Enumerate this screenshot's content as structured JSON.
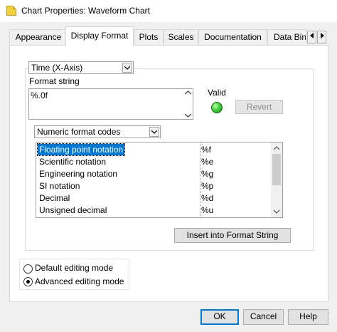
{
  "window": {
    "title": "Chart Properties: Waveform Chart"
  },
  "tabs": [
    {
      "label": "Appearance",
      "active": false
    },
    {
      "label": "Display Format",
      "active": true
    },
    {
      "label": "Plots",
      "active": false
    },
    {
      "label": "Scales",
      "active": false
    },
    {
      "label": "Documentation",
      "active": false
    },
    {
      "label": "Data Bin",
      "active": false
    }
  ],
  "tab_scroll": {
    "left_icon": "triangle-left-icon",
    "right_icon": "triangle-right-icon"
  },
  "display_format": {
    "axis_select": {
      "value": "Time (X-Axis)"
    },
    "format_string": {
      "label": "Format string",
      "value": "%.0f"
    },
    "valid": {
      "label": "Valid",
      "state": "on",
      "color": "#3ed13e"
    },
    "revert_button": {
      "label": "Revert",
      "enabled": false
    },
    "codes_select": {
      "value": "Numeric format codes"
    },
    "codes_list": [
      {
        "name": "Floating point notation",
        "code": "%f",
        "selected": true
      },
      {
        "name": "Scientific notation",
        "code": "%e",
        "selected": false
      },
      {
        "name": "Engineering notation",
        "code": "%g",
        "selected": false
      },
      {
        "name": "SI notation",
        "code": "%p",
        "selected": false
      },
      {
        "name": "Decimal",
        "code": "%d",
        "selected": false
      },
      {
        "name": "Unsigned decimal",
        "code": "%u",
        "selected": false
      }
    ],
    "insert_button": {
      "label": "Insert into Format String"
    },
    "editing_mode": {
      "options": [
        {
          "label": "Default editing mode",
          "checked": false
        },
        {
          "label": "Advanced editing mode",
          "checked": true
        }
      ]
    }
  },
  "footer": {
    "ok_label": "OK",
    "cancel_label": "Cancel",
    "help_label": "Help"
  },
  "colors": {
    "selection": "#0078d7",
    "dialog_bg": "#f0f0f0",
    "panel_bg": "#ffffff"
  }
}
